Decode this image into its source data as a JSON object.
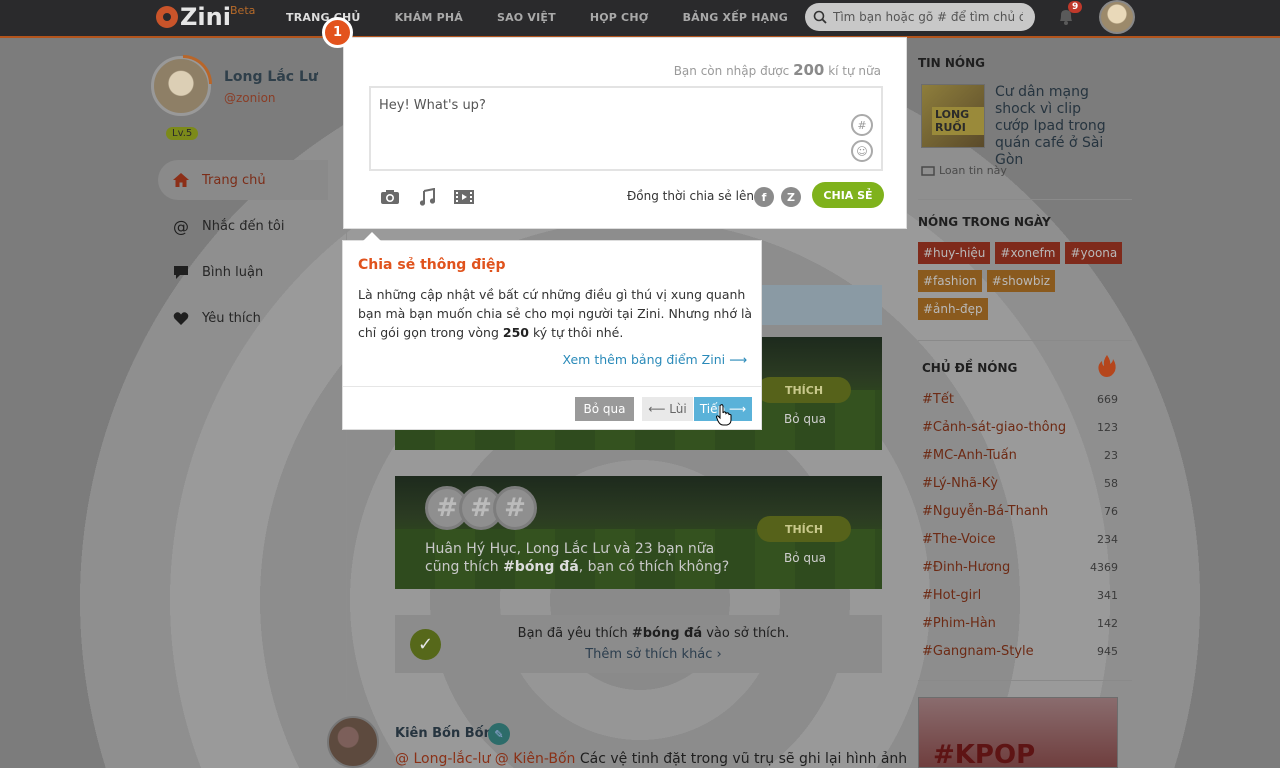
{
  "topbar": {
    "logo": "Zini",
    "beta": "Beta",
    "nav": [
      "TRANG CHỦ",
      "KHÁM PHÁ",
      "SAO VIỆT",
      "HỌP CHỢ",
      "BẢNG XẾP HẠNG"
    ],
    "search_placeholder": "Tìm bạn hoặc gõ # để tìm chủ đề",
    "notif_count": "9"
  },
  "profile": {
    "name": "Long Lắc Lư",
    "handle": "@zonion",
    "level": "Lv.5"
  },
  "side_menu": [
    {
      "label": "Trang chủ",
      "icon": "home-icon"
    },
    {
      "label": "Nhắc đến tôi",
      "icon": "at-icon"
    },
    {
      "label": "Bình luận",
      "icon": "comment-icon"
    },
    {
      "label": "Yêu thích",
      "icon": "heart-icon"
    }
  ],
  "composer": {
    "step": "1",
    "char_count_prefix": "Bạn còn nhập được",
    "char_count_value": "200",
    "char_count_suffix": "kí tự nữa",
    "placeholder": "Hey! What's up?",
    "share_also_label": "Đồng thời chia sẻ lên:",
    "facebook": "f",
    "zing": "Z",
    "share_button": "CHIA SẺ"
  },
  "tooltip": {
    "title": "Chia sẻ thông điệp",
    "body_1": "Là những cập nhật về bất cứ những điều gì thú vị xung quanh bạn mà bạn muốn chia sẻ cho mọi người tại Zini. Nhưng nhớ là chỉ gói gọn trong vòng ",
    "body_bold": "250",
    "body_2": " ký tự thôi nhé.",
    "link": "Xem thêm bảng điểm Zini ⟶",
    "skip": "Bỏ qua",
    "prev": "⟵ Lùi",
    "next": "Tiếp ⟶"
  },
  "feed": {
    "card1": {
      "like": "THÍCH",
      "skip": "Bỏ qua"
    },
    "card2": {
      "hash": "#",
      "text_1": "Huân Hý Hục, Long Lắc Lư và 23 bạn nữa cũng thích ",
      "text_bold": "#bóng đá",
      "text_2": ", bạn có thích không?",
      "like": "THÍCH",
      "skip": "Bỏ qua"
    },
    "liked": {
      "text_1": "Bạn đã yêu thích ",
      "text_bold": "#bóng đá",
      "text_2": " vào sở thích.",
      "more": "Thêm sở thích khác ›"
    },
    "post": {
      "author": "Kiên Bốn Bốn",
      "mentions": "@ Long-lắc-lư @ Kiên-Bốn",
      "text": " Các vệ tinh đặt trong vũ trụ sẽ ghi lại hình ảnh"
    }
  },
  "right": {
    "hot_news_title": "TIN NÓNG",
    "hot_thumb_text": "LONG RUỒI",
    "hot_news_headline": "Cư dân mạng shock vì clip cướp Ipad trong quán café ở Sài Gòn",
    "hot_share": "Loan tin này",
    "today_title": "NÓNG TRONG NGÀY",
    "tags": [
      {
        "label": "#huy-hiệu",
        "tone": "red"
      },
      {
        "label": "#xonefm",
        "tone": "red"
      },
      {
        "label": "#yoona",
        "tone": "red"
      },
      {
        "label": "#fashion",
        "tone": "orange"
      },
      {
        "label": "#showbiz",
        "tone": "orange"
      },
      {
        "label": "#ảnh-đẹp",
        "tone": "orange"
      }
    ],
    "topics_title": "CHỦ ĐỀ NÓNG",
    "topics": [
      {
        "name": "#Tết",
        "count": "669"
      },
      {
        "name": "#Cảnh-sát-giao-thông",
        "count": "123"
      },
      {
        "name": "#MC-Anh-Tuấn",
        "count": "23"
      },
      {
        "name": "#Lý-Nhã-Kỳ",
        "count": "58"
      },
      {
        "name": "#Nguyễn-Bá-Thanh",
        "count": "76"
      },
      {
        "name": "#The-Voice",
        "count": "234"
      },
      {
        "name": "#Đinh-Hương",
        "count": "4369"
      },
      {
        "name": "#Hot-girl",
        "count": "341"
      },
      {
        "name": "#Phim-Hàn",
        "count": "142"
      },
      {
        "name": "#Gangnam-Style",
        "count": "945"
      }
    ],
    "kpop": "#KPOP"
  }
}
